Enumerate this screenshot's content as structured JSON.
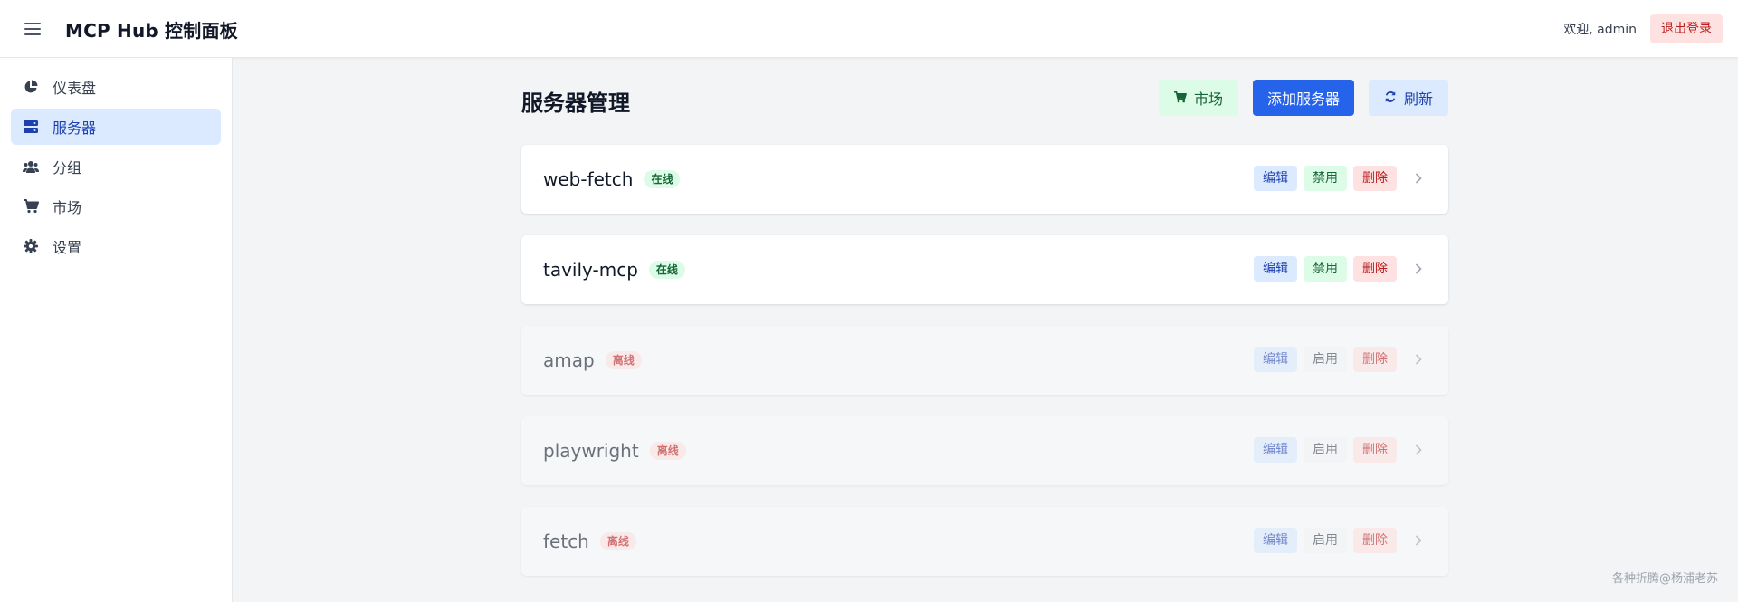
{
  "header": {
    "title": "MCP Hub 控制面板",
    "welcome": "欢迎, admin",
    "logout_label": "退出登录"
  },
  "sidebar": {
    "items": [
      {
        "label": "仪表盘",
        "icon": "pie-chart-icon",
        "active": false
      },
      {
        "label": "服务器",
        "icon": "server-icon",
        "active": true
      },
      {
        "label": "分组",
        "icon": "users-icon",
        "active": false
      },
      {
        "label": "市场",
        "icon": "cart-icon",
        "active": false
      },
      {
        "label": "设置",
        "icon": "gear-icon",
        "active": false
      }
    ]
  },
  "main": {
    "title": "服务器管理",
    "toolbar": {
      "market_label": "市场",
      "add_label": "添加服务器",
      "refresh_label": "刷新"
    },
    "servers": [
      {
        "name": "web-fetch",
        "status": "在线",
        "online": true,
        "edit": "编辑",
        "toggle": "禁用",
        "delete": "删除"
      },
      {
        "name": "tavily-mcp",
        "status": "在线",
        "online": true,
        "edit": "编辑",
        "toggle": "禁用",
        "delete": "删除"
      },
      {
        "name": "amap",
        "status": "离线",
        "online": false,
        "edit": "编辑",
        "toggle": "启用",
        "delete": "删除"
      },
      {
        "name": "playwright",
        "status": "离线",
        "online": false,
        "edit": "编辑",
        "toggle": "启用",
        "delete": "删除"
      },
      {
        "name": "fetch",
        "status": "离线",
        "online": false,
        "edit": "编辑",
        "toggle": "启用",
        "delete": "删除"
      }
    ]
  },
  "watermark": "各种折腾@杨浦老苏",
  "colors": {
    "accent": "#2563eb",
    "active_nav_bg": "#dbeafe",
    "online": "#166534",
    "offline": "#b91c1c"
  }
}
